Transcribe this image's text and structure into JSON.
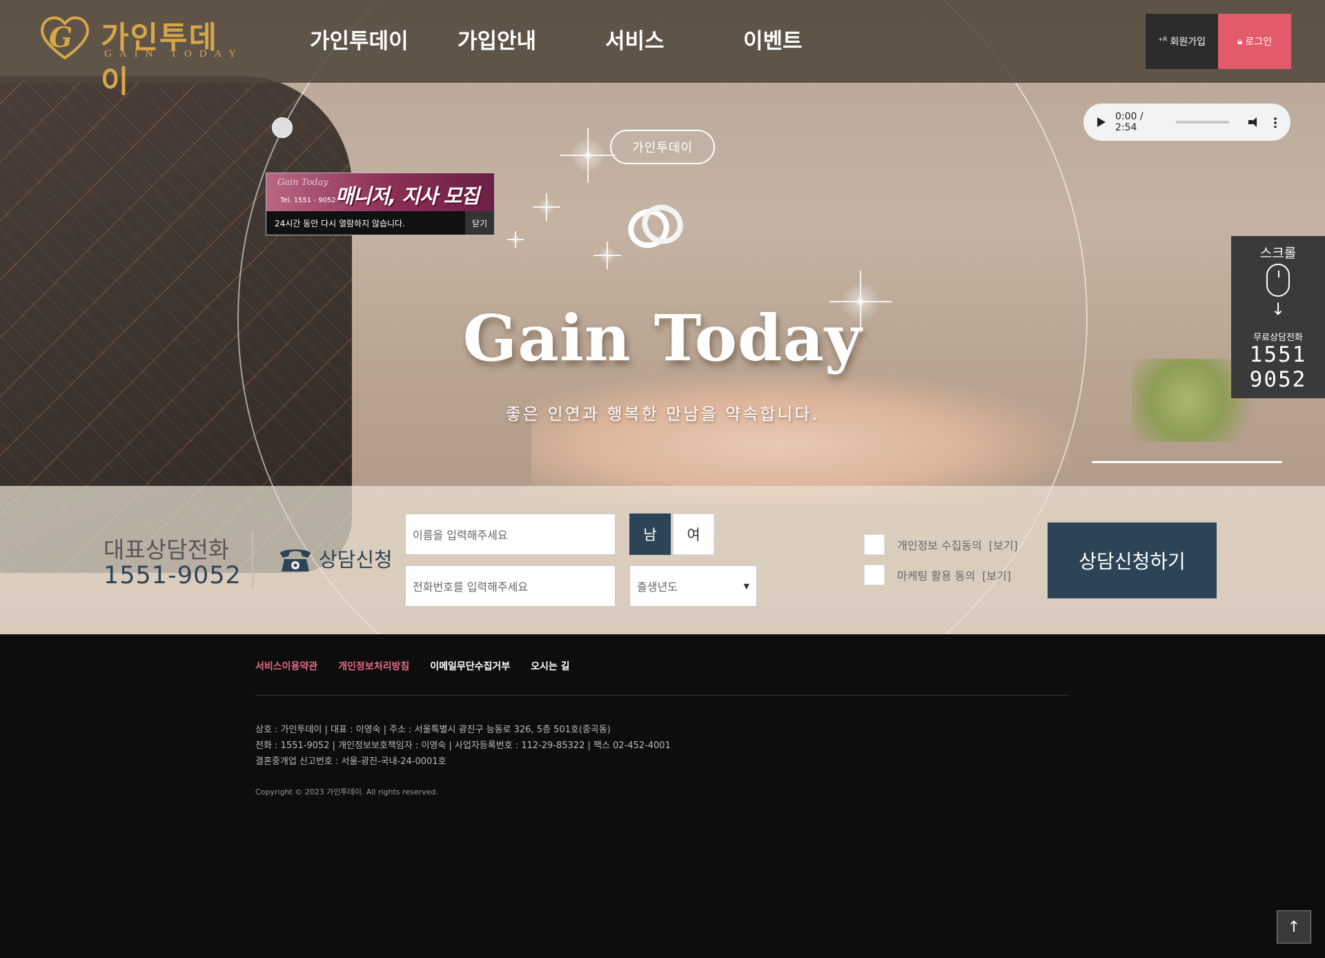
{
  "header": {
    "logo": {
      "korean": "가인투데이",
      "english": "GAIN TODAY"
    },
    "nav": [
      "가인투데이",
      "가입안내",
      "서비스",
      "이벤트"
    ],
    "join_label": "회원가입",
    "login_label": "로그인"
  },
  "audio": {
    "time": "0:00 / 2:54"
  },
  "popup": {
    "script": "Gain Today",
    "tel": "Tel. 1551 - 9052",
    "title": "매니저, 지사 모집",
    "message": "24시간 동안 다시 열람하지 않습니다.",
    "close_label": "닫기"
  },
  "hero": {
    "badge": "가인투데이",
    "title": "Gain Today",
    "subtitle": "좋은 인연과 행복한 만남을 약속합니다."
  },
  "side_widget": {
    "scroll_label": "스크롤",
    "phone_label": "무료상담전화",
    "phone_1": "1551",
    "phone_2": "9052"
  },
  "consult": {
    "title": "대표상담전화",
    "phone": "1551-9052",
    "apply_label": "상담신청",
    "name_placeholder": "이름을 입력해주세요",
    "phone_placeholder": "전화번호를 입력해주세요",
    "gender_male": "남",
    "gender_female": "여",
    "birth_year": "출생년도",
    "agree_privacy": "개인정보 수집동의",
    "agree_marketing": "마케팅 활용 동의",
    "view_label": "[보기]",
    "submit_label": "상담신청하기"
  },
  "footer": {
    "links": [
      "서비스이용약관",
      "개인정보처리방침",
      "이메일무단수집거부",
      "오시는 길"
    ],
    "info_1": "상호 : 가인투데이 | 대표 : 이영숙 | 주소 : 서울특별시 광진구 능동로 326, 5층 501호(중곡동)",
    "info_2": "전화 : 1551-9052 | 개인정보보호책임자 : 이영숙 | 사업자등록번호 : 112-29-85322 | 팩스 02-452-4001",
    "info_3": "결혼중개업 신고번호 : 서울-광진-국내-24-0001호",
    "copyright": "Copyright © 2023 가인투데이. All rights reserved."
  },
  "colors": {
    "accent_gold": "#d7a64a",
    "navy": "#2d4456",
    "login_pink": "#e35a6a",
    "link_pink": "#ea6b85"
  }
}
